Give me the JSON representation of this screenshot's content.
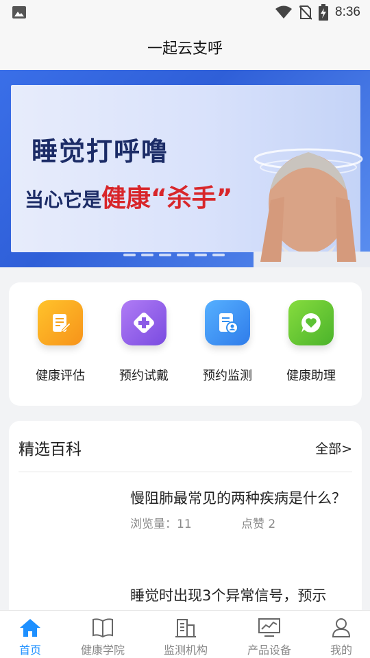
{
  "status_bar": {
    "time": "8:36"
  },
  "header": {
    "title": "一起云支呼"
  },
  "banner": {
    "line1": "睡觉打呼噜",
    "line2_prefix": "当心它是",
    "line2_highlight": "健康“杀手”"
  },
  "quick_actions": [
    {
      "label": "健康评估",
      "icon": "clipboard-edit-icon",
      "color": "#f7a21b"
    },
    {
      "label": "预约试戴",
      "icon": "medical-cross-icon",
      "color": "#8b5be6"
    },
    {
      "label": "预约监测",
      "icon": "report-user-icon",
      "color": "#2f8ef0"
    },
    {
      "label": "健康助理",
      "icon": "heart-chat-icon",
      "color": "#5cc234"
    }
  ],
  "wiki": {
    "title": "精选百科",
    "all_link": "全部>",
    "articles": [
      {
        "title": "慢阻肺最常见的两种疾病是什么？",
        "views": "浏览量：11",
        "likes": "点赞 2"
      },
      {
        "title": "睡觉时出现3个异常信号，预示"
      }
    ]
  },
  "tabs": [
    {
      "label": "首页",
      "icon": "home-icon",
      "active": true
    },
    {
      "label": "健康学院",
      "icon": "book-icon",
      "active": false
    },
    {
      "label": "监测机构",
      "icon": "building-icon",
      "active": false
    },
    {
      "label": "产品设备",
      "icon": "monitor-chart-icon",
      "active": false
    },
    {
      "label": "我的",
      "icon": "user-icon",
      "active": false
    }
  ],
  "colors": {
    "accent": "#1e90ff",
    "banner_red": "#d8262a",
    "banner_navy": "#1b2b66"
  }
}
